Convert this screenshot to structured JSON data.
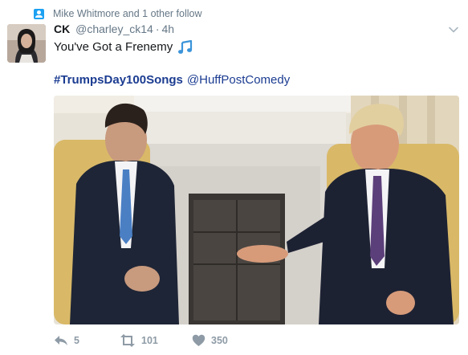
{
  "context": {
    "text": "Mike Whitmore and 1 other follow",
    "icon": "follow-icon"
  },
  "tweet": {
    "author_name": "CK",
    "handle": "@charley_ck14",
    "separator": "·",
    "time": "4h",
    "text": "You've Got a Frenemy",
    "emoji_icon": "musical-notes-icon",
    "hashtag": "#TrumpsDay100Songs",
    "mention": "@HuffPostComedy"
  },
  "actions": {
    "reply_count": "5",
    "retweet_count": "101",
    "like_count": "350"
  },
  "colors": {
    "accent": "#1da1f2",
    "link": "#1b3c91",
    "muted": "#657786",
    "action": "#8e9ba6"
  }
}
